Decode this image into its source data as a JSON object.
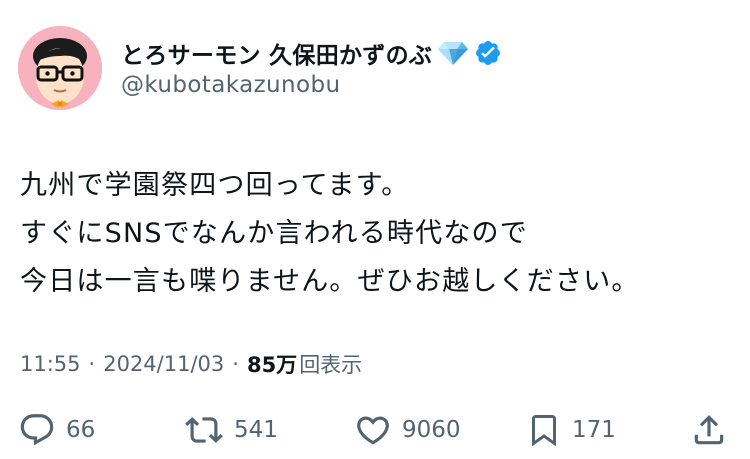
{
  "author": {
    "display_name": "とろサーモン 久保田かずのぶ",
    "handle": "@kubotakazunobu",
    "badges": [
      "gem-icon",
      "verified-icon"
    ],
    "verified_color": "#1d9bf0"
  },
  "tweet": {
    "lines": [
      "九州で学園祭四つ回ってます。",
      "すぐにSNSでなんか言われる時代なので",
      "今日は一言も喋りません。ぜひお越しください。"
    ],
    "time": "11:55",
    "separator": "·",
    "date": "2024/11/03",
    "views_count": "85万",
    "views_label": "回表示"
  },
  "actions": {
    "reply": {
      "icon": "reply-icon",
      "count": "66"
    },
    "retweet": {
      "icon": "retweet-icon",
      "count": "541"
    },
    "like": {
      "icon": "heart-icon",
      "count": "9060"
    },
    "bookmark": {
      "icon": "bookmark-icon",
      "count": "171"
    },
    "share": {
      "icon": "share-icon"
    }
  },
  "colors": {
    "text": "#0f1419",
    "secondary": "#536471",
    "avatar_bg": "#f7b2be"
  }
}
